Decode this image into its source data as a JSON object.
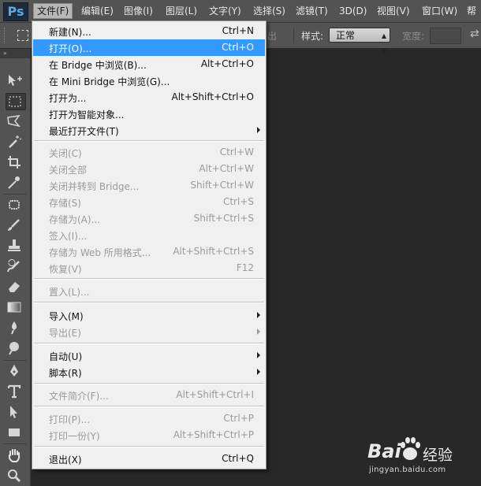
{
  "app": {
    "logo": "Ps"
  },
  "menubar": {
    "items": [
      {
        "label": "文件(F)",
        "active": true
      },
      {
        "label": "编辑(E)"
      },
      {
        "label": "图像(I)"
      },
      {
        "label": "图层(L)"
      },
      {
        "label": "文字(Y)"
      },
      {
        "label": "选择(S)"
      },
      {
        "label": "滤镜(T)"
      },
      {
        "label": "3D(D)"
      },
      {
        "label": "视图(V)"
      },
      {
        "label": "窗口(W)"
      },
      {
        "label": "帮"
      }
    ]
  },
  "options": {
    "partial_label": "出",
    "style_label": "样式:",
    "style_value": "正常",
    "width_label": "宽度:"
  },
  "file_menu": {
    "items": [
      {
        "label": "新建(N)...",
        "shortcut": "Ctrl+N",
        "enabled": true
      },
      {
        "label": "打开(O)...",
        "shortcut": "Ctrl+O",
        "enabled": true,
        "highlighted": true
      },
      {
        "label": "在 Bridge 中浏览(B)...",
        "shortcut": "Alt+Ctrl+O",
        "enabled": true
      },
      {
        "label": "在 Mini Bridge 中浏览(G)...",
        "shortcut": "",
        "enabled": true
      },
      {
        "label": "打开为...",
        "shortcut": "Alt+Shift+Ctrl+O",
        "enabled": true
      },
      {
        "label": "打开为智能对象...",
        "shortcut": "",
        "enabled": true
      },
      {
        "label": "最近打开文件(T)",
        "shortcut": "",
        "enabled": true,
        "submenu": true
      },
      {
        "label": "关闭(C)",
        "shortcut": "Ctrl+W",
        "enabled": false
      },
      {
        "label": "关闭全部",
        "shortcut": "Alt+Ctrl+W",
        "enabled": false
      },
      {
        "label": "关闭并转到 Bridge...",
        "shortcut": "Shift+Ctrl+W",
        "enabled": false
      },
      {
        "label": "存储(S)",
        "shortcut": "Ctrl+S",
        "enabled": false
      },
      {
        "label": "存储为(A)...",
        "shortcut": "Shift+Ctrl+S",
        "enabled": false
      },
      {
        "label": "签入(I)...",
        "shortcut": "",
        "enabled": false
      },
      {
        "label": "存储为 Web 所用格式...",
        "shortcut": "Alt+Shift+Ctrl+S",
        "enabled": false
      },
      {
        "label": "恢复(V)",
        "shortcut": "F12",
        "enabled": false
      },
      {
        "label": "置入(L)...",
        "shortcut": "",
        "enabled": false
      },
      {
        "label": "导入(M)",
        "shortcut": "",
        "enabled": true,
        "submenu": true
      },
      {
        "label": "导出(E)",
        "shortcut": "",
        "enabled": false,
        "submenu": true
      },
      {
        "label": "自动(U)",
        "shortcut": "",
        "enabled": true,
        "submenu": true
      },
      {
        "label": "脚本(R)",
        "shortcut": "",
        "enabled": true,
        "submenu": true
      },
      {
        "label": "文件简介(F)...",
        "shortcut": "Alt+Shift+Ctrl+I",
        "enabled": false
      },
      {
        "label": "打印(P)...",
        "shortcut": "Ctrl+P",
        "enabled": false
      },
      {
        "label": "打印一份(Y)",
        "shortcut": "Alt+Shift+Ctrl+P",
        "enabled": false
      },
      {
        "label": "退出(X)",
        "shortcut": "Ctrl+Q",
        "enabled": true
      }
    ]
  },
  "toolbar": {
    "tools": [
      "move-tool-icon",
      "rect-marquee-tool-icon",
      "lasso-tool-icon",
      "magic-wand-tool-icon",
      "crop-tool-icon",
      "eyedropper-tool-icon",
      "spot-healing-tool-icon",
      "brush-tool-icon",
      "clone-stamp-tool-icon",
      "history-brush-tool-icon",
      "eraser-tool-icon",
      "gradient-tool-icon",
      "blur-tool-icon",
      "dodge-tool-icon",
      "pen-tool-icon",
      "type-tool-icon",
      "path-selection-tool-icon",
      "rectangle-tool-icon",
      "hand-tool-icon",
      "zoom-tool-icon"
    ],
    "selected": "rect-marquee-tool-icon"
  },
  "watermark": {
    "brand": "Bai",
    "brand_cn": "经验",
    "url": "jingyan.baidu.com"
  },
  "colors": {
    "menu_highlight": "#3399ff",
    "panel_bg": "#535353",
    "canvas_bg": "#282828"
  }
}
